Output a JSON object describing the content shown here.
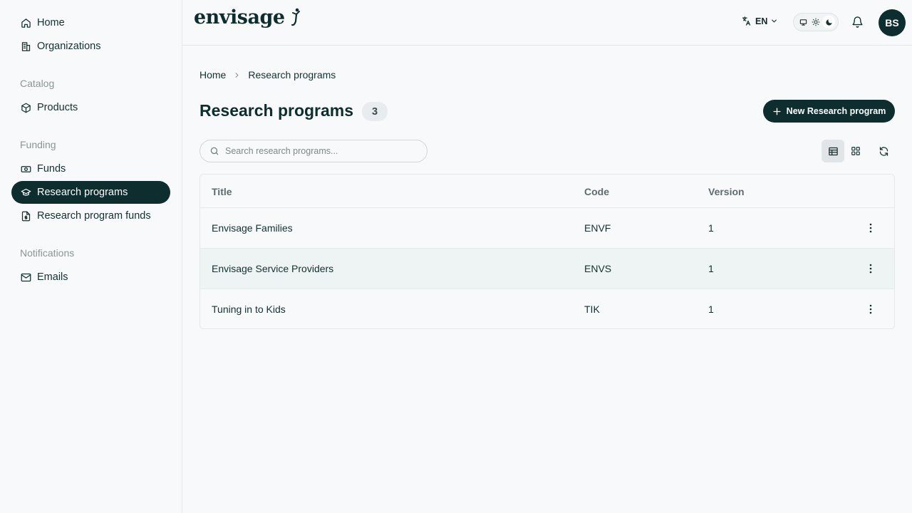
{
  "sidebar": {
    "home": "Home",
    "organizations": "Organizations",
    "catalog_label": "Catalog",
    "products": "Products",
    "funding_label": "Funding",
    "funds": "Funds",
    "research_programs": "Research programs",
    "research_program_funds": "Research program funds",
    "notifications_label": "Notifications",
    "emails": "Emails"
  },
  "header": {
    "logo": "envisage",
    "language": "EN",
    "avatar_initials": "BS"
  },
  "breadcrumb": {
    "home": "Home",
    "current": "Research programs"
  },
  "page": {
    "title": "Research programs",
    "count": "3",
    "new_button": "New Research program",
    "search_placeholder": "Search research programs..."
  },
  "table": {
    "columns": [
      "Title",
      "Code",
      "Version"
    ],
    "rows": [
      {
        "title": "Envisage Families",
        "code": "ENVF",
        "version": "1"
      },
      {
        "title": "Envisage Service Providers",
        "code": "ENVS",
        "version": "1"
      },
      {
        "title": "Tuning in to Kids",
        "code": "TIK",
        "version": "1"
      }
    ]
  },
  "colors": {
    "primary": "#0d2d2f",
    "background": "#f8f9fb",
    "row_highlight": "#eef3f3"
  }
}
